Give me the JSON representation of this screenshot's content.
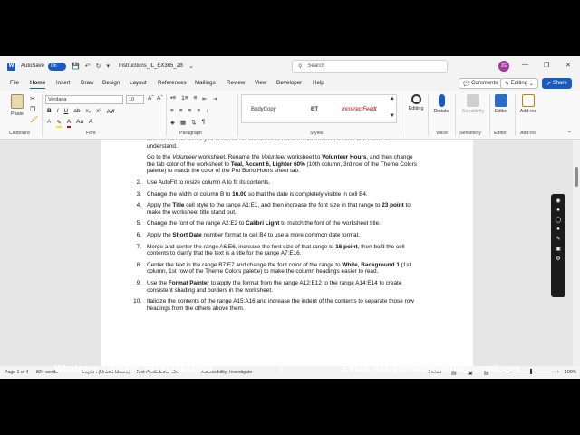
{
  "titlebar": {
    "autosave_label": "AutoSave",
    "autosave_state": "On",
    "doc_title": "Instructions_IL_EX365_2B",
    "search_placeholder": "Search",
    "avatar_initials": "JG"
  },
  "menu": {
    "tabs": [
      "File",
      "Home",
      "Insert",
      "Draw",
      "Design",
      "Layout",
      "References",
      "Mailings",
      "Review",
      "View",
      "Developer",
      "Help"
    ],
    "active_tab": "Home",
    "comments_label": "Comments",
    "editing_label": "Editing",
    "share_label": "Share"
  },
  "ribbon": {
    "paste_label": "Paste",
    "clipboard_label": "Clipboard",
    "font_name": "Verdana",
    "font_size": "10",
    "font_label": "Font",
    "paragraph_label": "Paragraph",
    "styles_label": "Styles",
    "styles": [
      "BodyCopy",
      "BT",
      "IncorrectFeedt"
    ],
    "editing_btn": "Editing",
    "dictate_btn": "Dictate",
    "voice_label": "Voice",
    "sensitivity_btn": "Sensitivity",
    "sensitivity_label": "Sensitivity",
    "editor_btn": "Editor",
    "editor_label": "Editor",
    "addins_btn": "Add-ins",
    "addins_label": "Add-ins"
  },
  "document": {
    "intro_1": "events. He has asked you to format his workbook to make the information clearer and easier to understand.",
    "intro_2a": "Go to the ",
    "intro_2b": "Volunteer",
    "intro_2c": " worksheet. Rename the ",
    "intro_2d": "Volunteer",
    "intro_2e": " worksheet to ",
    "intro_2f": "Volunteer Hours",
    "intro_2g": ", and then change the tab color of the worksheet to ",
    "intro_2h": "Teal, Accent 6, Lighter 60%",
    "intro_2i": " (10th column, 3rd row of the Theme Colors palette) to match the color of the Pro Bono Hours sheet tab.",
    "items": [
      {
        "num": "2.",
        "parts": [
          "Use AutoFit to resize column A to fit its contents."
        ]
      },
      {
        "num": "3.",
        "parts": [
          "Change the width of column B to ",
          "16.00",
          " so that the date is completely visible in cell B4."
        ]
      },
      {
        "num": "4.",
        "parts": [
          "Apply the ",
          "Title",
          " cell style to the range A1:E1, and then increase the font size in that range to ",
          "23 point",
          " to make the worksheet title stand out."
        ]
      },
      {
        "num": "5.",
        "parts": [
          "Change the font of the range A2:E2 to ",
          "Calibri Light",
          " to match the font of the worksheet title."
        ]
      },
      {
        "num": "6.",
        "parts": [
          "Apply the ",
          "Short Date",
          " number format to cell B4 to use a more common date format."
        ]
      },
      {
        "num": "7.",
        "parts": [
          "Merge and center the range A6:E6, increase the font size of that range to ",
          "16 point",
          ", then bold the cell contents to clarify that the text is a title for the range A7:E16."
        ]
      },
      {
        "num": "8.",
        "parts": [
          "Center the text in the range B7:E7 and change the font color of the range to ",
          "White, Background 1",
          " (1st column, 1st row of the Theme Colors palette) to make the column headings easier to read."
        ]
      },
      {
        "num": "9.",
        "parts": [
          "Use the ",
          "Format Painter",
          " to apply the format from the range A12:E12 to the range A14:E14 to create consistent shading and borders in the worksheet."
        ]
      },
      {
        "num": "10.",
        "parts": [
          "Italicize the contents of the range A15:A16 and increase the indent of the contents to separate those row headings from the others above them."
        ]
      }
    ]
  },
  "status": {
    "page": "Page 1 of 4",
    "words": "834 words",
    "language": "English (United States)",
    "predictions": "Text Predictions: On",
    "accessibility": "Accessibility: Investigate",
    "focus": "Focus",
    "zoom": "100%"
  },
  "footer": {
    "whatsapp": "Whatsapp Contact: +919116641093",
    "email": "Email: assignmentstutorial@gmail.com"
  }
}
